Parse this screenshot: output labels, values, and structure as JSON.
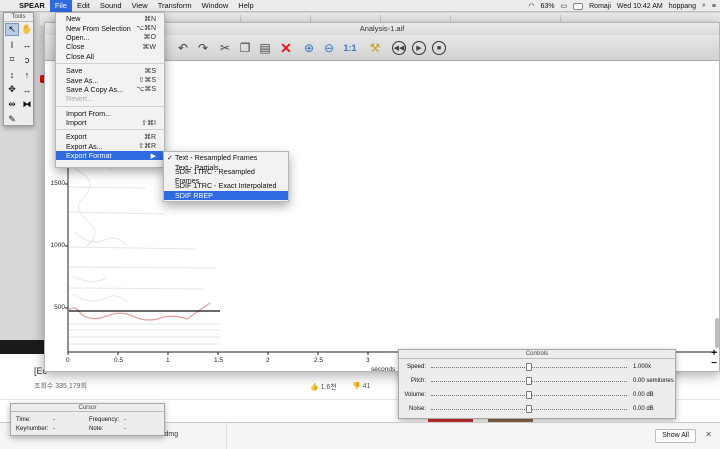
{
  "menubar": {
    "app": "SPEAR",
    "items": [
      "File",
      "Edit",
      "Sound",
      "View",
      "Transform",
      "Window",
      "Help"
    ],
    "status": {
      "input": "Romaji",
      "datetime": "Wed 10:42 AM",
      "user": "hoppang",
      "battery": "63%"
    }
  },
  "browser": {
    "tabs": [
      "",
      "",
      "",
      "",
      ""
    ],
    "video_title": "[Ec",
    "views": "조회수 335,179회",
    "likes": "1.6천",
    "dislikes": "41",
    "download_file": "...latest.dmg",
    "show_all": "Show All"
  },
  "window": {
    "title": "Analysis-1.aif"
  },
  "tools": {
    "title": "Tools"
  },
  "file_menu": {
    "items": [
      {
        "label": "New",
        "shortcut": "⌘N"
      },
      {
        "label": "New From Selection",
        "shortcut": "⌥⌘N"
      },
      {
        "label": "Open...",
        "shortcut": "⌘O"
      },
      {
        "label": "Close",
        "shortcut": "⌘W"
      },
      {
        "label": "Close All",
        "shortcut": ""
      },
      {
        "label": "Save",
        "shortcut": "⌘S"
      },
      {
        "label": "Save As...",
        "shortcut": "⇧⌘S"
      },
      {
        "label": "Save A Copy As...",
        "shortcut": "⌥⌘S"
      },
      {
        "label": "Revert...",
        "shortcut": ""
      },
      {
        "label": "Import From...",
        "shortcut": ""
      },
      {
        "label": "Import",
        "shortcut": "⇧⌘I"
      },
      {
        "label": "Export",
        "shortcut": "⌘R"
      },
      {
        "label": "Export As...",
        "shortcut": "⇧⌘R"
      },
      {
        "label": "Export Format",
        "shortcut": "▶"
      }
    ]
  },
  "export_submenu": {
    "items": [
      {
        "label": "Text - Resampled Frames",
        "checked": "✓"
      },
      {
        "label": "Text - Partials",
        "checked": ""
      },
      {
        "label": "SDIF 1TRC - Resampled Frames",
        "checked": ""
      },
      {
        "label": "SDIF 1TRC - Exact Interpolated",
        "checked": ""
      },
      {
        "label": "SDIF RBEP",
        "checked": ""
      }
    ]
  },
  "plot": {
    "y_ticks": [
      "1500",
      "1000",
      "500"
    ],
    "x_ticks": [
      "0",
      "0.5",
      "1",
      "1.5",
      "2",
      "2.5",
      "3"
    ],
    "x_label": "seconds"
  },
  "controls": {
    "title": "Controls",
    "rows": [
      {
        "label": "Speed:",
        "value": "1.000x",
        "level": 0.5
      },
      {
        "label": "Pitch:",
        "value": "0.00 semitones",
        "level": 0.5
      },
      {
        "label": "Volume:",
        "value": "0.00 dB",
        "level": 0.5
      },
      {
        "label": "Noise:",
        "value": "0.00 dB",
        "level": 0.5
      }
    ]
  },
  "cursor": {
    "title": "Cursor",
    "time_label": "Time:",
    "time_value": "-",
    "frequency_label": "Frequency:",
    "frequency_value": "-",
    "keynumber_label": "Keynumber:",
    "keynumber_value": "-",
    "note_label": "Note:",
    "note_value": "-"
  }
}
